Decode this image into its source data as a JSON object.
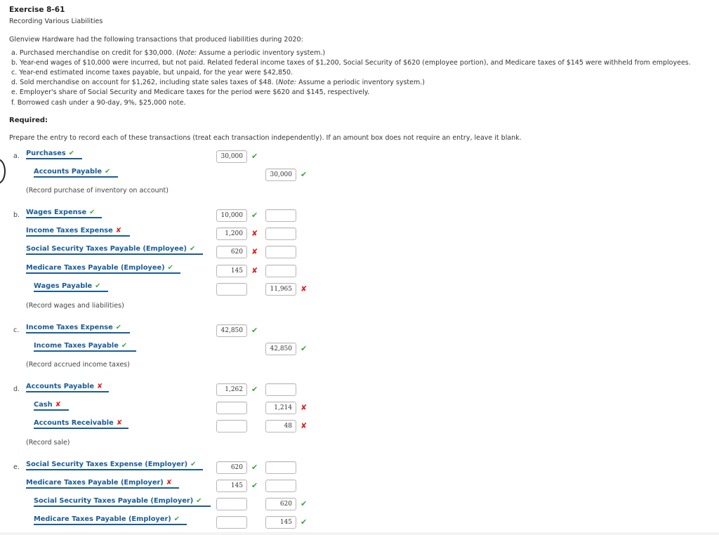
{
  "header": {
    "title": "Exercise 8-61",
    "subtitle": "Recording Various Liabilities"
  },
  "intro": "Glenview Hardware had the following transactions that produced liabilities during 2020:",
  "transactions": [
    {
      "pre": "a. Purchased merchandise on credit for $30,000. (",
      "note": "Note:",
      "post": " Assume a periodic inventory system.)"
    },
    {
      "pre": "b. Year-end wages of $10,000 were incurred, but not paid. Related federal income taxes of $1,200, Social Security of $620 (employee portion), and Medicare taxes of $145 were withheld from employees.",
      "note": "",
      "post": ""
    },
    {
      "pre": "c. Year-end estimated income taxes payable, but unpaid, for the year were $42,850.",
      "note": "",
      "post": ""
    },
    {
      "pre": "d. Sold merchandise on account for $1,262, including state sales taxes of $48. (",
      "note": "Note:",
      "post": " Assume a periodic inventory system.)"
    },
    {
      "pre": "e. Employer's share of Social Security and Medicare taxes for the period were $620 and $145, respectively.",
      "note": "",
      "post": ""
    },
    {
      "pre": "f. Borrowed cash under a 90-day, 9%, $25,000 note.",
      "note": "",
      "post": ""
    }
  ],
  "required_label": "Required:",
  "instructions": "Prepare the entry to record each of these transactions (treat each transaction independently). If an amount box does not require an entry, leave it blank.",
  "marks": {
    "correct": "✔",
    "incorrect": "✘"
  },
  "entries": [
    {
      "letter": "a.",
      "memo": "(Record purchase of inventory on account)",
      "lines": [
        {
          "account": "Purchases",
          "account_status": "correct",
          "debit": "30,000",
          "debit_status": "correct",
          "credit": null,
          "credit_status": ""
        },
        {
          "account": "Accounts Payable",
          "account_status": "correct",
          "debit": null,
          "debit_status": "",
          "credit": "30,000",
          "credit_status": "correct"
        }
      ]
    },
    {
      "letter": "b.",
      "memo": "(Record wages and liabilities)",
      "lines": [
        {
          "account": "Wages Expense",
          "account_status": "correct",
          "debit": "10,000",
          "debit_status": "correct",
          "credit": "",
          "credit_status": ""
        },
        {
          "account": "Income Taxes Expense",
          "account_status": "incorrect",
          "debit": "1,200",
          "debit_status": "incorrect",
          "credit": "",
          "credit_status": ""
        },
        {
          "account": "Social Security Taxes Payable (Employee)",
          "account_status": "correct",
          "debit": "620",
          "debit_status": "incorrect",
          "credit": "",
          "credit_status": ""
        },
        {
          "account": "Medicare Taxes Payable (Employee)",
          "account_status": "correct",
          "debit": "145",
          "debit_status": "incorrect",
          "credit": "",
          "credit_status": ""
        },
        {
          "account": "Wages Payable",
          "account_status": "correct",
          "debit": "",
          "debit_status": "",
          "credit": "11,965",
          "credit_status": "incorrect"
        }
      ]
    },
    {
      "letter": "c.",
      "memo": "(Record accrued income taxes)",
      "lines": [
        {
          "account": "Income Taxes Expense",
          "account_status": "correct",
          "debit": "42,850",
          "debit_status": "correct",
          "credit": null,
          "credit_status": ""
        },
        {
          "account": "Income Taxes Payable",
          "account_status": "correct",
          "debit": null,
          "debit_status": "",
          "credit": "42,850",
          "credit_status": "correct"
        }
      ]
    },
    {
      "letter": "d.",
      "memo": "(Record sale)",
      "lines": [
        {
          "account": "Accounts Payable",
          "account_status": "incorrect",
          "debit": "1,262",
          "debit_status": "correct",
          "credit": "",
          "credit_status": ""
        },
        {
          "account": "Cash",
          "account_status": "incorrect",
          "debit": "",
          "debit_status": "",
          "credit": "1,214",
          "credit_status": "incorrect"
        },
        {
          "account": "Accounts Receivable",
          "account_status": "incorrect",
          "debit": "",
          "debit_status": "",
          "credit": "48",
          "credit_status": "incorrect"
        }
      ]
    },
    {
      "letter": "e.",
      "memo": "",
      "lines": [
        {
          "account": "Social Security Taxes Expense (Employer)",
          "account_status": "correct",
          "debit": "620",
          "debit_status": "correct",
          "credit": "",
          "credit_status": ""
        },
        {
          "account": "Medicare Taxes Payable (Employer)",
          "account_status": "incorrect",
          "debit": "145",
          "debit_status": "correct",
          "credit": "",
          "credit_status": ""
        },
        {
          "account": "Social Security Taxes Payable (Employer)",
          "account_status": "correct",
          "debit": "",
          "debit_status": "",
          "credit": "620",
          "credit_status": "correct"
        },
        {
          "account": "Medicare Taxes Payable (Employer)",
          "account_status": "correct",
          "debit": "",
          "debit_status": "",
          "credit": "145",
          "credit_status": "correct"
        }
      ]
    }
  ]
}
